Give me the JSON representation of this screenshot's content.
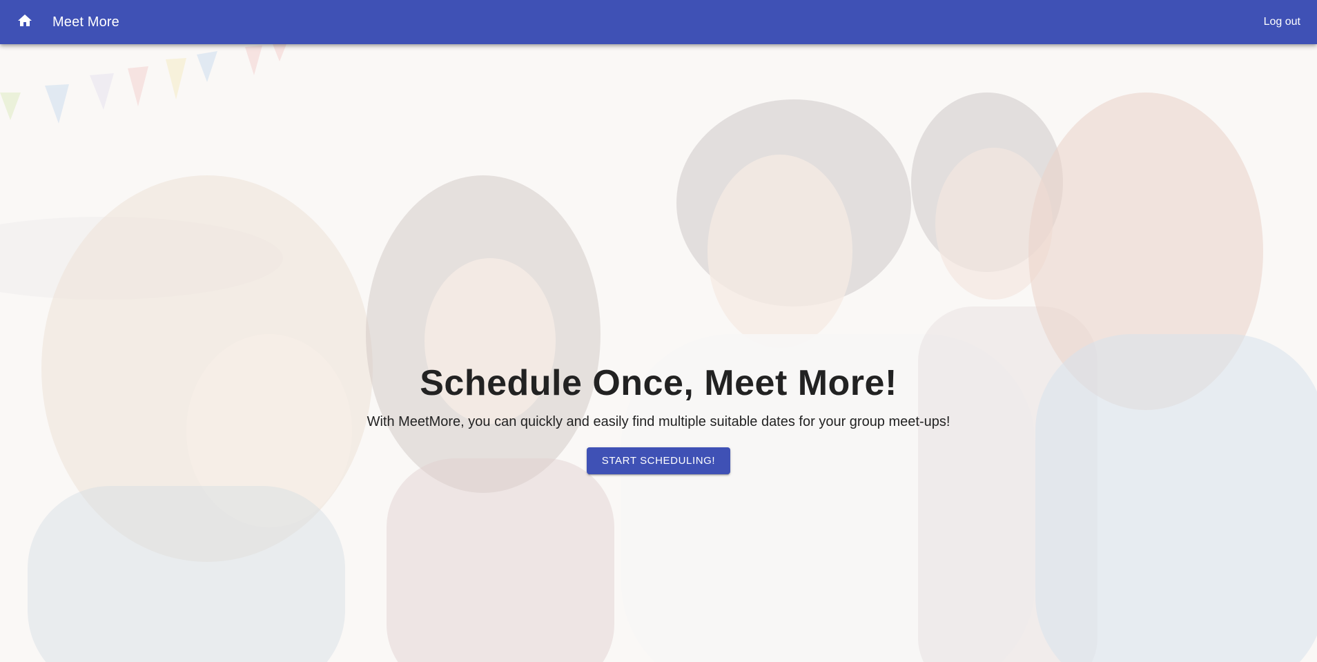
{
  "app_bar": {
    "home_icon": "home-icon",
    "title": "Meet More",
    "logout_label": "Log out",
    "background_color": "#3f51b5"
  },
  "hero": {
    "headline": "Schedule Once, Meet More!",
    "subline": "With MeetMore, you can quickly and easily find multiple suitable dates for your group meet-ups!",
    "cta_label": "START SCHEDULING!",
    "cta_color": "#3f51b5",
    "background_image": "faded photo of laughing group of friends at outdoor party with bunting flags"
  }
}
